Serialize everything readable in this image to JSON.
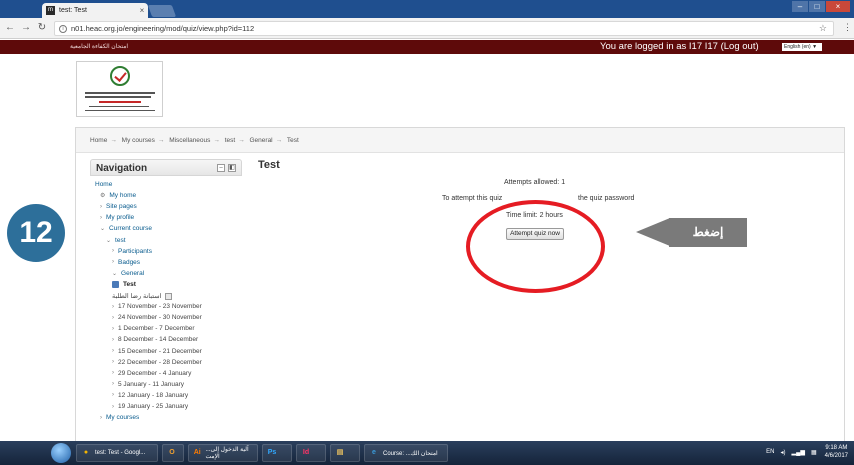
{
  "browser": {
    "tab_title": "test: Test",
    "favicon": "m",
    "close_glyph": "×",
    "url": "n01.heac.org.jo/engineering/mod/quiz/view.php?id=112",
    "window_buttons": [
      "–",
      "□",
      "×"
    ]
  },
  "header": {
    "site_arabic": "امتحان الكفاءة الجامعية",
    "login_text": "You are logged in as I17 I17 (Log out)",
    "language": "English (en) ▼"
  },
  "breadcrumb": [
    "Home",
    "My courses",
    "Miscellaneous",
    "test",
    "General",
    "Test"
  ],
  "navigation": {
    "title": "Navigation",
    "items": [
      {
        "label": "Home",
        "indent": 0,
        "caret": ""
      },
      {
        "label": "My home",
        "indent": 1,
        "caret": "⚙"
      },
      {
        "label": "Site pages",
        "indent": 1,
        "caret": "›"
      },
      {
        "label": "My profile",
        "indent": 1,
        "caret": "›"
      },
      {
        "label": "Current course",
        "indent": 1,
        "caret": "⌄"
      },
      {
        "label": "test",
        "indent": 2,
        "caret": "⌄"
      },
      {
        "label": "Participants",
        "indent": 3,
        "caret": "›"
      },
      {
        "label": "Badges",
        "indent": 3,
        "caret": "›"
      },
      {
        "label": "General",
        "indent": 3,
        "caret": "⌄"
      },
      {
        "label": "Test",
        "indent": 3,
        "caret": ""
      },
      {
        "label": "استبانة رضا الطلبة",
        "indent": 3,
        "caret": ""
      },
      {
        "label": "17 November - 23 November",
        "indent": 3,
        "caret": "›"
      },
      {
        "label": "24 November - 30 November",
        "indent": 3,
        "caret": "›"
      },
      {
        "label": "1 December - 7 December",
        "indent": 3,
        "caret": "›"
      },
      {
        "label": "8 December - 14 December",
        "indent": 3,
        "caret": "›"
      },
      {
        "label": "15 December - 21 December",
        "indent": 3,
        "caret": "›"
      },
      {
        "label": "22 December - 28 December",
        "indent": 3,
        "caret": "›"
      },
      {
        "label": "29 December - 4 January",
        "indent": 3,
        "caret": "›"
      },
      {
        "label": "5 January - 11 January",
        "indent": 3,
        "caret": "›"
      },
      {
        "label": "12 January - 18 January",
        "indent": 3,
        "caret": "›"
      },
      {
        "label": "19 January - 25 January",
        "indent": 3,
        "caret": "›"
      },
      {
        "label": "My courses",
        "indent": 1,
        "caret": "›"
      }
    ]
  },
  "main": {
    "page_title": "Test",
    "attempts_allowed": "Attempts allowed: 1",
    "password_note_start": "To attempt this quiz",
    "password_note_end": "the quiz password",
    "time_limit": "Time limit: 2 hours",
    "attempt_button": "Attempt quiz now"
  },
  "annotations": {
    "step_number": "12",
    "arrow_label": "إضغط",
    "circle_color": "#e51c23",
    "badge_color": "#2d6f9a",
    "arrow_color": "#7a7a7a"
  },
  "taskbar": {
    "tasks": [
      {
        "label": "test: Test - Googl...",
        "icon": "chrome-icon",
        "glyph": "●",
        "color": "#f4b400"
      },
      {
        "label": "",
        "icon": "outlook-icon",
        "glyph": "O",
        "color": "#f0a030"
      },
      {
        "label": "...آلية الدخول إلى الإمت",
        "icon": "illustrator-icon",
        "glyph": "Ai",
        "color": "#ff7c00"
      },
      {
        "label": "",
        "icon": "photoshop-icon",
        "glyph": "Ps",
        "color": "#31a8ff"
      },
      {
        "label": "",
        "icon": "indesign-icon",
        "glyph": "Id",
        "color": "#ff3366"
      },
      {
        "label": "",
        "icon": "explorer-icon",
        "glyph": "▤",
        "color": "#e8c060"
      },
      {
        "label": "Course: ...امتحان الك",
        "icon": "ie-icon",
        "glyph": "e",
        "color": "#3a9ad9"
      }
    ],
    "tray_lang": "EN",
    "time": "9:18 AM",
    "date": "4/6/2017"
  }
}
